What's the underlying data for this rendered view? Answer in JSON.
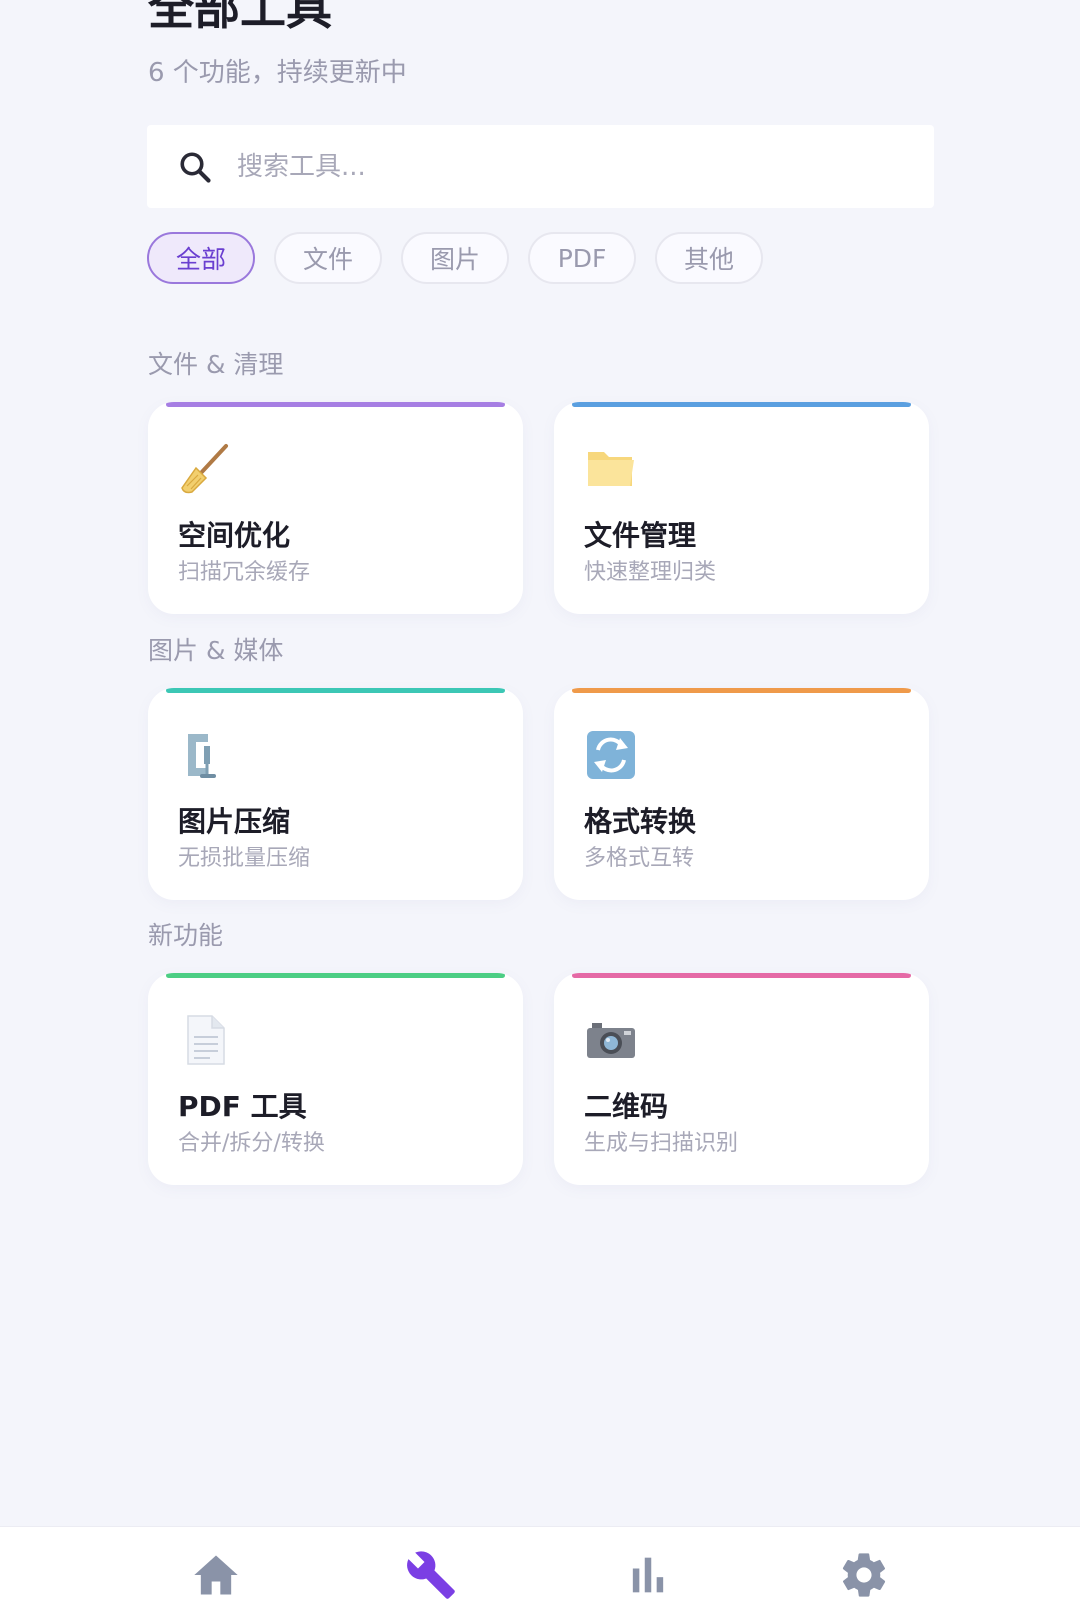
{
  "header": {
    "title": "全部工具",
    "subtitle": "6 个功能，持续更新中"
  },
  "search": {
    "placeholder": "搜索工具..."
  },
  "filters": [
    {
      "label": "全部",
      "active": true
    },
    {
      "label": "文件",
      "active": false
    },
    {
      "label": "图片",
      "active": false
    },
    {
      "label": "PDF",
      "active": false
    },
    {
      "label": "其他",
      "active": false
    }
  ],
  "sections": [
    {
      "label": "文件 & 清理",
      "cards": [
        {
          "title": "空间优化",
          "desc": "扫描冗余缓存",
          "icon": "broom-icon",
          "accent": "#a67ee3"
        },
        {
          "title": "文件管理",
          "desc": "快速整理归类",
          "icon": "folder-icon",
          "accent": "#5a9fe0"
        }
      ]
    },
    {
      "label": "图片 & 媒体",
      "cards": [
        {
          "title": "图片压缩",
          "desc": "无损批量压缩",
          "icon": "clamp-icon",
          "accent": "#3cc7b5"
        },
        {
          "title": "格式转换",
          "desc": "多格式互转",
          "icon": "convert-icon",
          "accent": "#ef9a4a"
        }
      ]
    },
    {
      "label": "新功能",
      "cards": [
        {
          "title": "PDF 工具",
          "desc": "合并/拆分/转换",
          "icon": "document-icon",
          "accent": "#4cce84"
        },
        {
          "title": "二维码",
          "desc": "生成与扫描识别",
          "icon": "camera-icon",
          "accent": "#e56aa6"
        }
      ]
    }
  ],
  "bottom_nav": [
    {
      "icon": "home-icon",
      "active": false
    },
    {
      "icon": "wrench-icon",
      "active": true
    },
    {
      "icon": "stats-icon",
      "active": false
    },
    {
      "icon": "gear-icon",
      "active": false
    }
  ],
  "colors": {
    "accent": "#7b3fe4",
    "background": "#f4f5fb",
    "nav_inactive": "#8a93a8"
  }
}
